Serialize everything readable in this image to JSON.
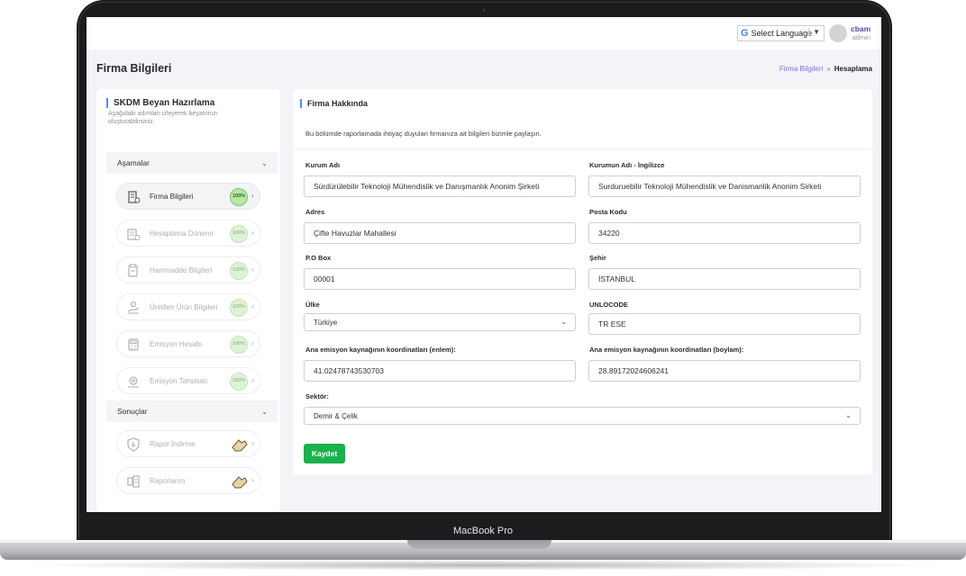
{
  "device": {
    "model_label": "MacBook Pro"
  },
  "topbar": {
    "language_select": "Select Language",
    "language_arrow": "▼",
    "user_name": "cbam",
    "user_role": "admin"
  },
  "header": {
    "title": "Firma Bilgileri",
    "breadcrumb": {
      "first": "Firma Bilgileri",
      "separator": "»",
      "current": "Hesaplama"
    }
  },
  "sidebar": {
    "title": "SKDM Beyan Hazırlama",
    "subtitle": "Aşağıdaki adımları izleyerek beyanınızı oluşturabilirsiniz.",
    "section_stages": "Aşamalar",
    "steps": [
      {
        "label": "Firma Bilgileri",
        "icon": "building-coins-icon",
        "badge": "100%"
      },
      {
        "label": "Hesaplama Dönemi",
        "icon": "calendar-building-icon",
        "badge": "100%"
      },
      {
        "label": "Hammadde Bilgileri",
        "icon": "box-clipboard-icon",
        "badge": "100%"
      },
      {
        "label": "Üretilen Ürün Bilgileri",
        "icon": "hand-coins-icon",
        "badge": "100%"
      },
      {
        "label": "Emisyon Hesabı",
        "icon": "calculator-icon",
        "badge": "100%"
      },
      {
        "label": "Emisyon Tahsisatı",
        "icon": "gear-money-icon",
        "badge": "100%"
      }
    ],
    "section_results": "Sonuçlar",
    "results": [
      {
        "label": "Rapor İndirme",
        "icon": "shield-download-icon"
      },
      {
        "label": "Raporlarım",
        "icon": "report-list-icon"
      }
    ],
    "accent_color": "#4f8df7"
  },
  "form": {
    "title": "Firma Hakkında",
    "description": "Bu bölümde raporlamada ihtiyaç duyulan firmanıza ait bilgileri bizimle paylaşın.",
    "fields": {
      "kurum_adi": {
        "label": "Kurum Adı",
        "value": "Sürdürülebilir Teknoloji Mühendislik ve Danışmanlık Anonim Şirketi"
      },
      "kurum_adi_en": {
        "label": "Kurumun Adı - İngilizce",
        "value": "Surduruebilir Teknoloji Mühendislik ve Danismanlik Anonim Sirketi"
      },
      "adres": {
        "label": "Adres",
        "value": "Çifte Havuzlar Mahallesi"
      },
      "posta_kodu": {
        "label": "Posta Kodu",
        "value": "34220"
      },
      "po_box": {
        "label": "P.O Box",
        "value": "00001"
      },
      "sehir": {
        "label": "Şehir",
        "value": "İSTANBUL"
      },
      "ulke": {
        "label": "Ülke",
        "value": "Türkiye"
      },
      "unlocode": {
        "label": "UNLOCODE",
        "value": "TR ESE"
      },
      "enlem": {
        "label": "Ana emisyon kaynağının koordinatları (enlem):",
        "value": "41.02478743530703"
      },
      "boylam": {
        "label": "Ana emisyon kaynağının koordinatları (boylam):",
        "value": "28.89172024606241"
      },
      "sektor": {
        "label": "Sektör:",
        "value": "Demir & Çelik"
      }
    },
    "save_label": "Kaydet",
    "save_color": "#1bb14c"
  }
}
